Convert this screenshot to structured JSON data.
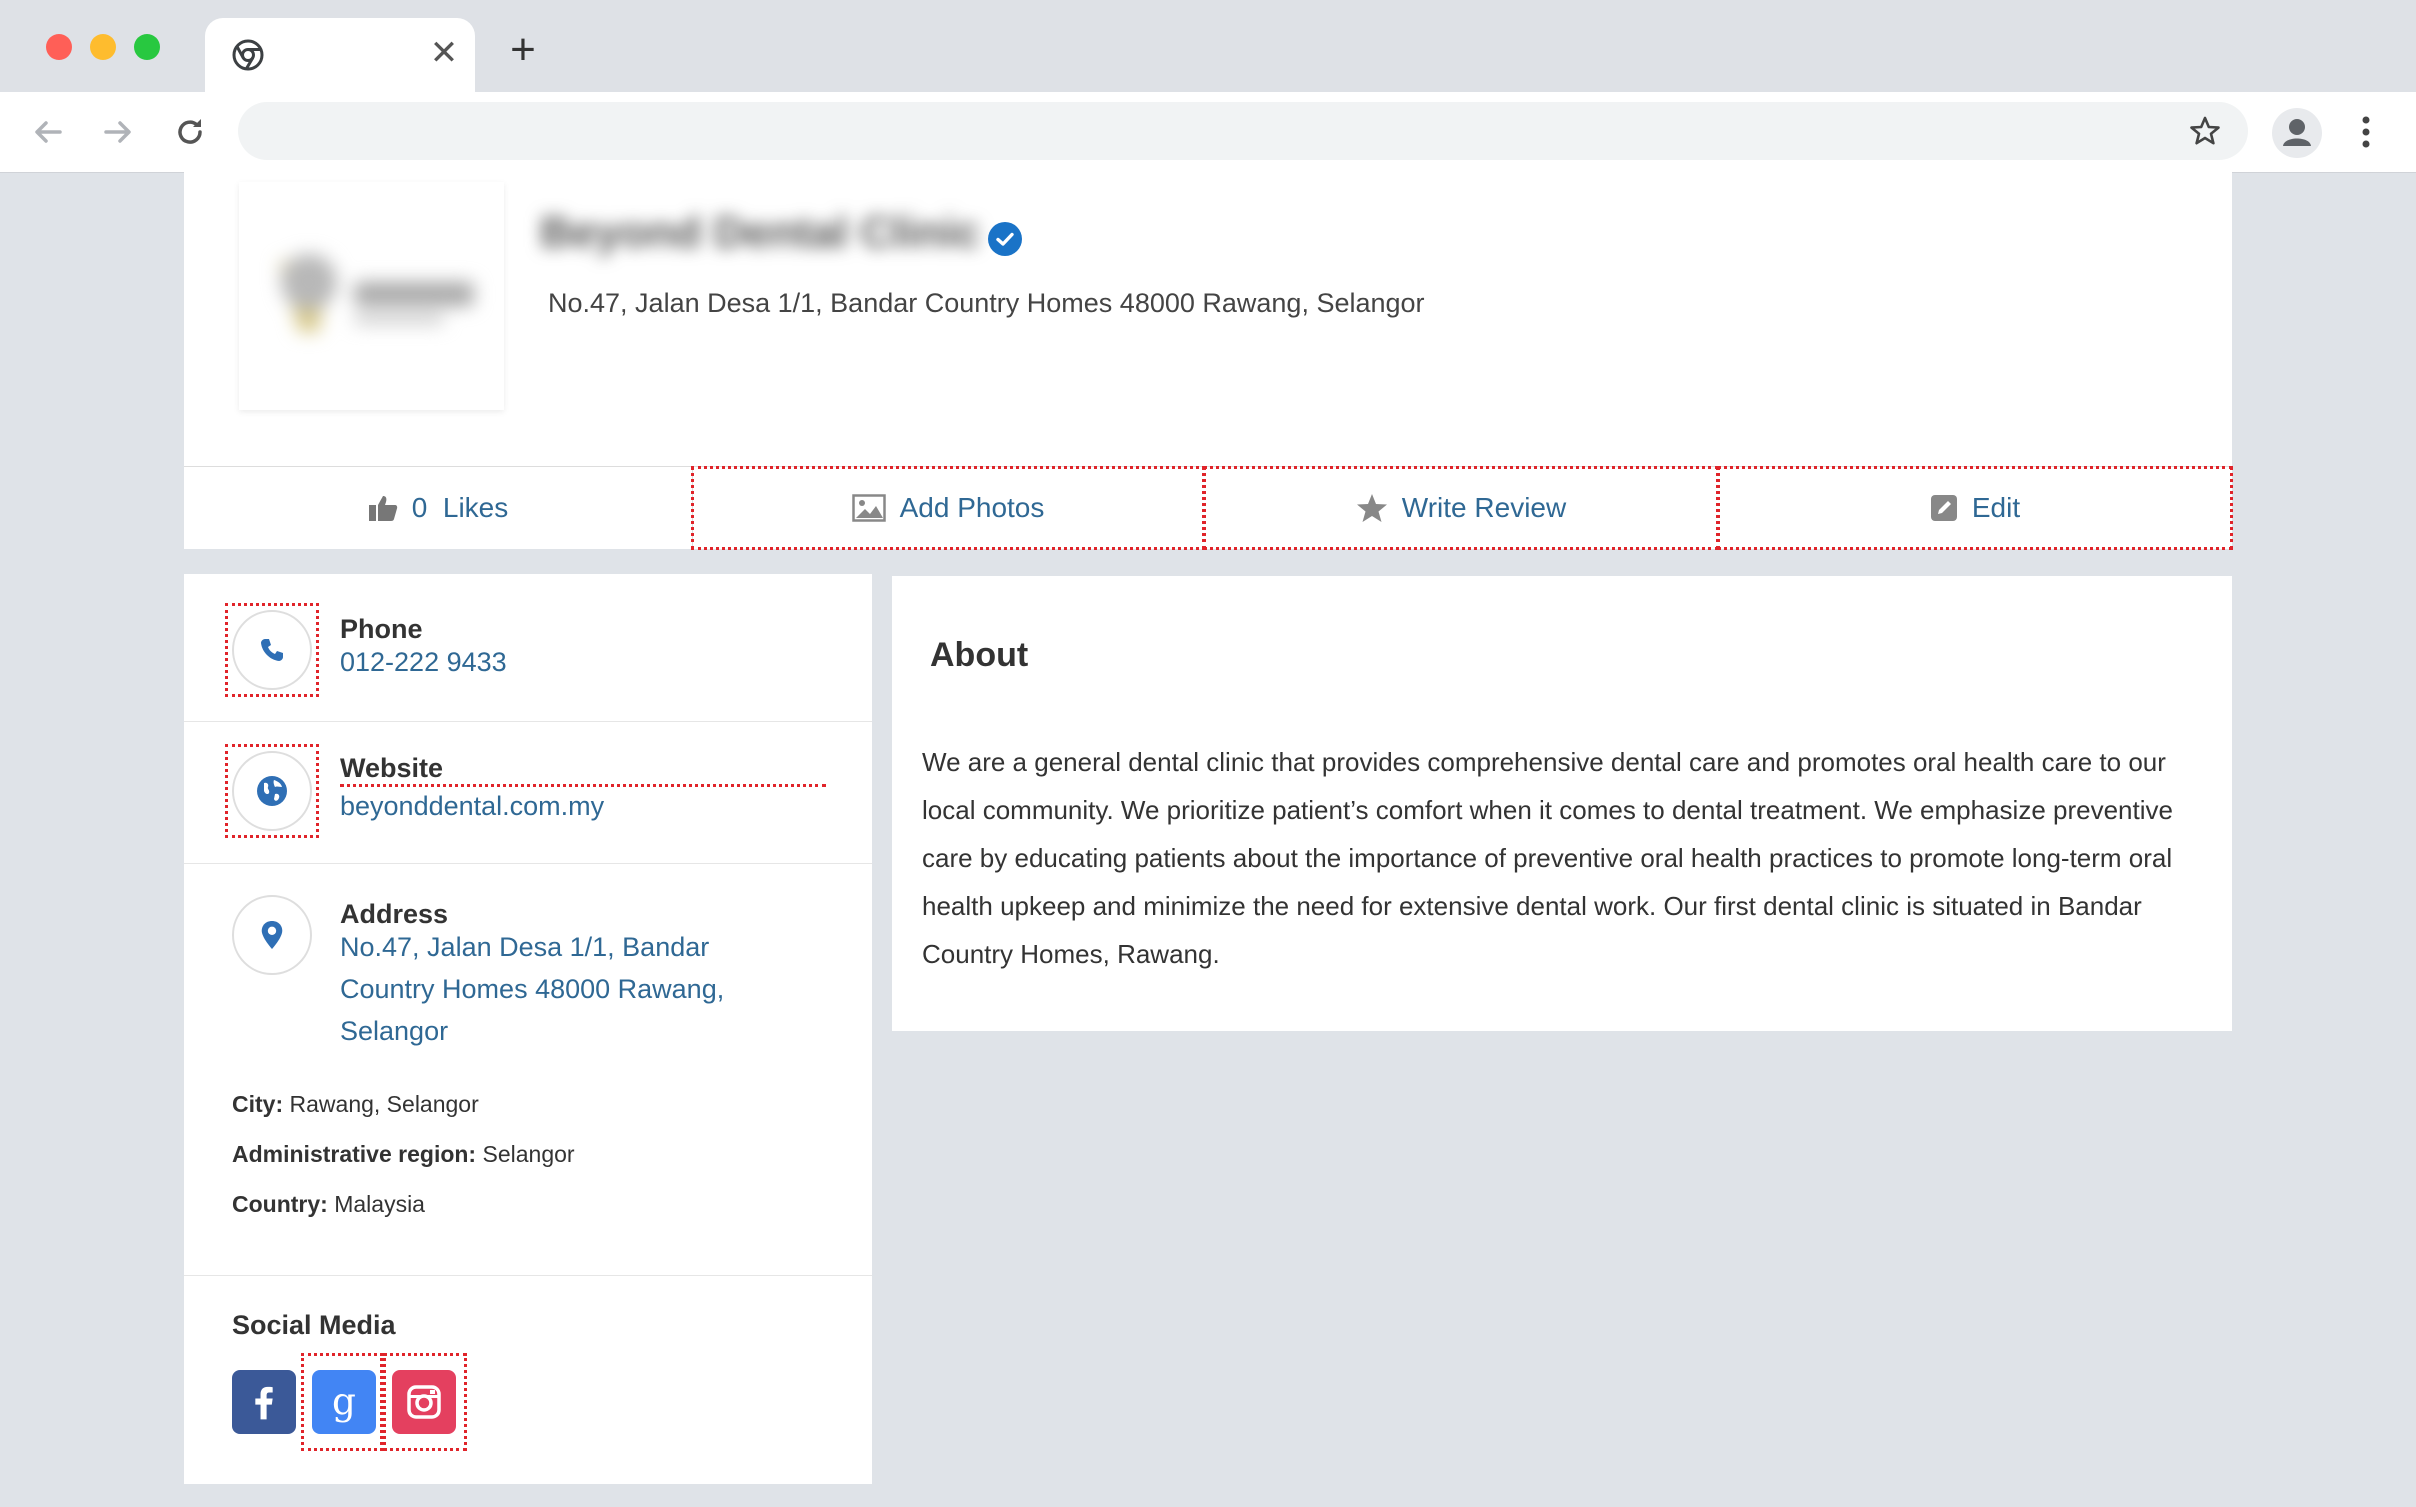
{
  "browser": {
    "tab_title": "",
    "address_url": "",
    "close_glyph": "✕",
    "newtab_glyph": "+"
  },
  "listing": {
    "business_name": "Beyond Dental Clinic",
    "address": "No.47, Jalan Desa 1/1, Bandar Country Homes 48000 Rawang, Selangor",
    "verified": true
  },
  "actions": {
    "likes_count": "0",
    "likes_label": "Likes",
    "add_photos": "Add Photos",
    "write_review": "Write Review",
    "edit": "Edit"
  },
  "contact": {
    "phone_label": "Phone",
    "phone_value": "012-222 9433",
    "website_label": "Website",
    "website_value": "beyonddental.com.my",
    "address_label": "Address",
    "address_value": "No.47, Jalan Desa 1/1, Bandar Country Homes 48000 Rawang, Selangor",
    "city_label": "City:",
    "city_value": "Rawang, Selangor",
    "region_label": "Administrative region:",
    "region_value": "Selangor",
    "country_label": "Country:",
    "country_value": "Malaysia"
  },
  "social": {
    "title": "Social Media",
    "icons": [
      "facebook-icon",
      "google-icon",
      "instagram-icon"
    ]
  },
  "about": {
    "title": "About",
    "text": "We are a general dental clinic that provides comprehensive dental care and promotes oral health care to our local community. We prioritize patient’s comfort when it comes to dental treatment. We emphasize preventive care by educating patients about the importance of preventive oral health practices to promote long-term oral health upkeep and minimize the need for extensive dental work. Our first dental clinic is situated in Bandar Country Homes, Rawang."
  },
  "colors": {
    "link": "#2f6894",
    "facebook": "#3b5998",
    "google": "#4285f4",
    "instagram": "#e4405f",
    "highlight": "#e0242a"
  }
}
